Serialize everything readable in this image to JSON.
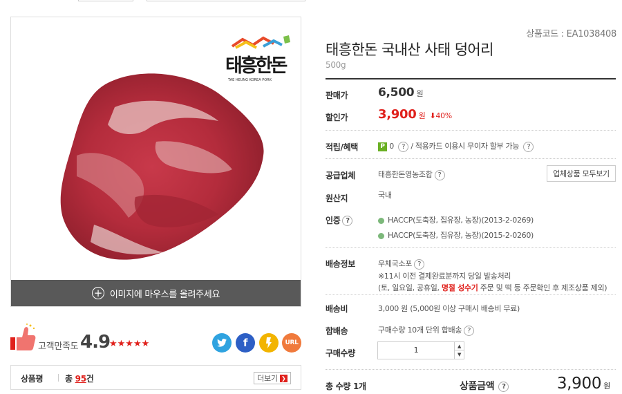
{
  "image": {
    "hover_text": "이미지에 마우스를 올려주세요",
    "brand_logo": "태흥한돈",
    "brand_sub": "TAE HEUNG KOREA PORK"
  },
  "satisfaction": {
    "label": "고객만족도",
    "score": "4.9",
    "stars": "★★★★★",
    "rating": 4.9
  },
  "share": {
    "twitter_icon": "t",
    "facebook_icon": "f",
    "kakao_icon": "kakaostory",
    "url_label": "URL"
  },
  "review": {
    "title": "상품평",
    "prefix": "총",
    "count": "95",
    "suffix": "건",
    "more_label": "더보기"
  },
  "product": {
    "code": "상품코드 : EA1038408",
    "title": "태흥한돈 국내산 사태 덩어리",
    "weight": "500g"
  },
  "price": {
    "sale_label": "판매가",
    "sale_value": "6,500",
    "discount_label": "할인가",
    "discount_value": "3,900",
    "won": "원",
    "discount_rate": "40%"
  },
  "benefit": {
    "label": "적립/혜택",
    "points": "0",
    "sep": "/",
    "card_text": "적용카드 이용시 무이자 할부 가능"
  },
  "supplier": {
    "label": "공급업체",
    "name": "태흥한돈영농조합",
    "all_button": "업체상품 모두보기"
  },
  "origin": {
    "label": "원산지",
    "value": "국내"
  },
  "certification": {
    "label": "인증",
    "items": [
      "HACCP(도축장, 집유장, 농장)(2013-2-0269)",
      "HACCP(도축장, 집유장, 농장)(2015-2-0260)"
    ]
  },
  "shipping": {
    "label": "배송정보",
    "method": "우체국소포",
    "note1": "※11시 이전 결제완료분까지 당일 발송처리",
    "note2_pre": "(토, 일요일, 공휴일,",
    "note2_bold": "명절 성수기",
    "note2_post": "주문 및 떡 등 주문확인 후 제조상품 제외)"
  },
  "fee": {
    "label": "배송비",
    "value": "3,000 원 (5,000원 이상 구매시 배송비 무료)"
  },
  "combine": {
    "label": "합배송",
    "value": "구매수량 10개 단위 합배송"
  },
  "quantity": {
    "label": "구매수량",
    "value": "1"
  },
  "total": {
    "qty_label": "총 수량 1개",
    "amount_label": "상품금액",
    "amount_value": "3,900",
    "won": "원"
  },
  "colors": {
    "accent_red": "#e0211c",
    "hover_bar": "#595959",
    "point_green": "#6ab023"
  }
}
